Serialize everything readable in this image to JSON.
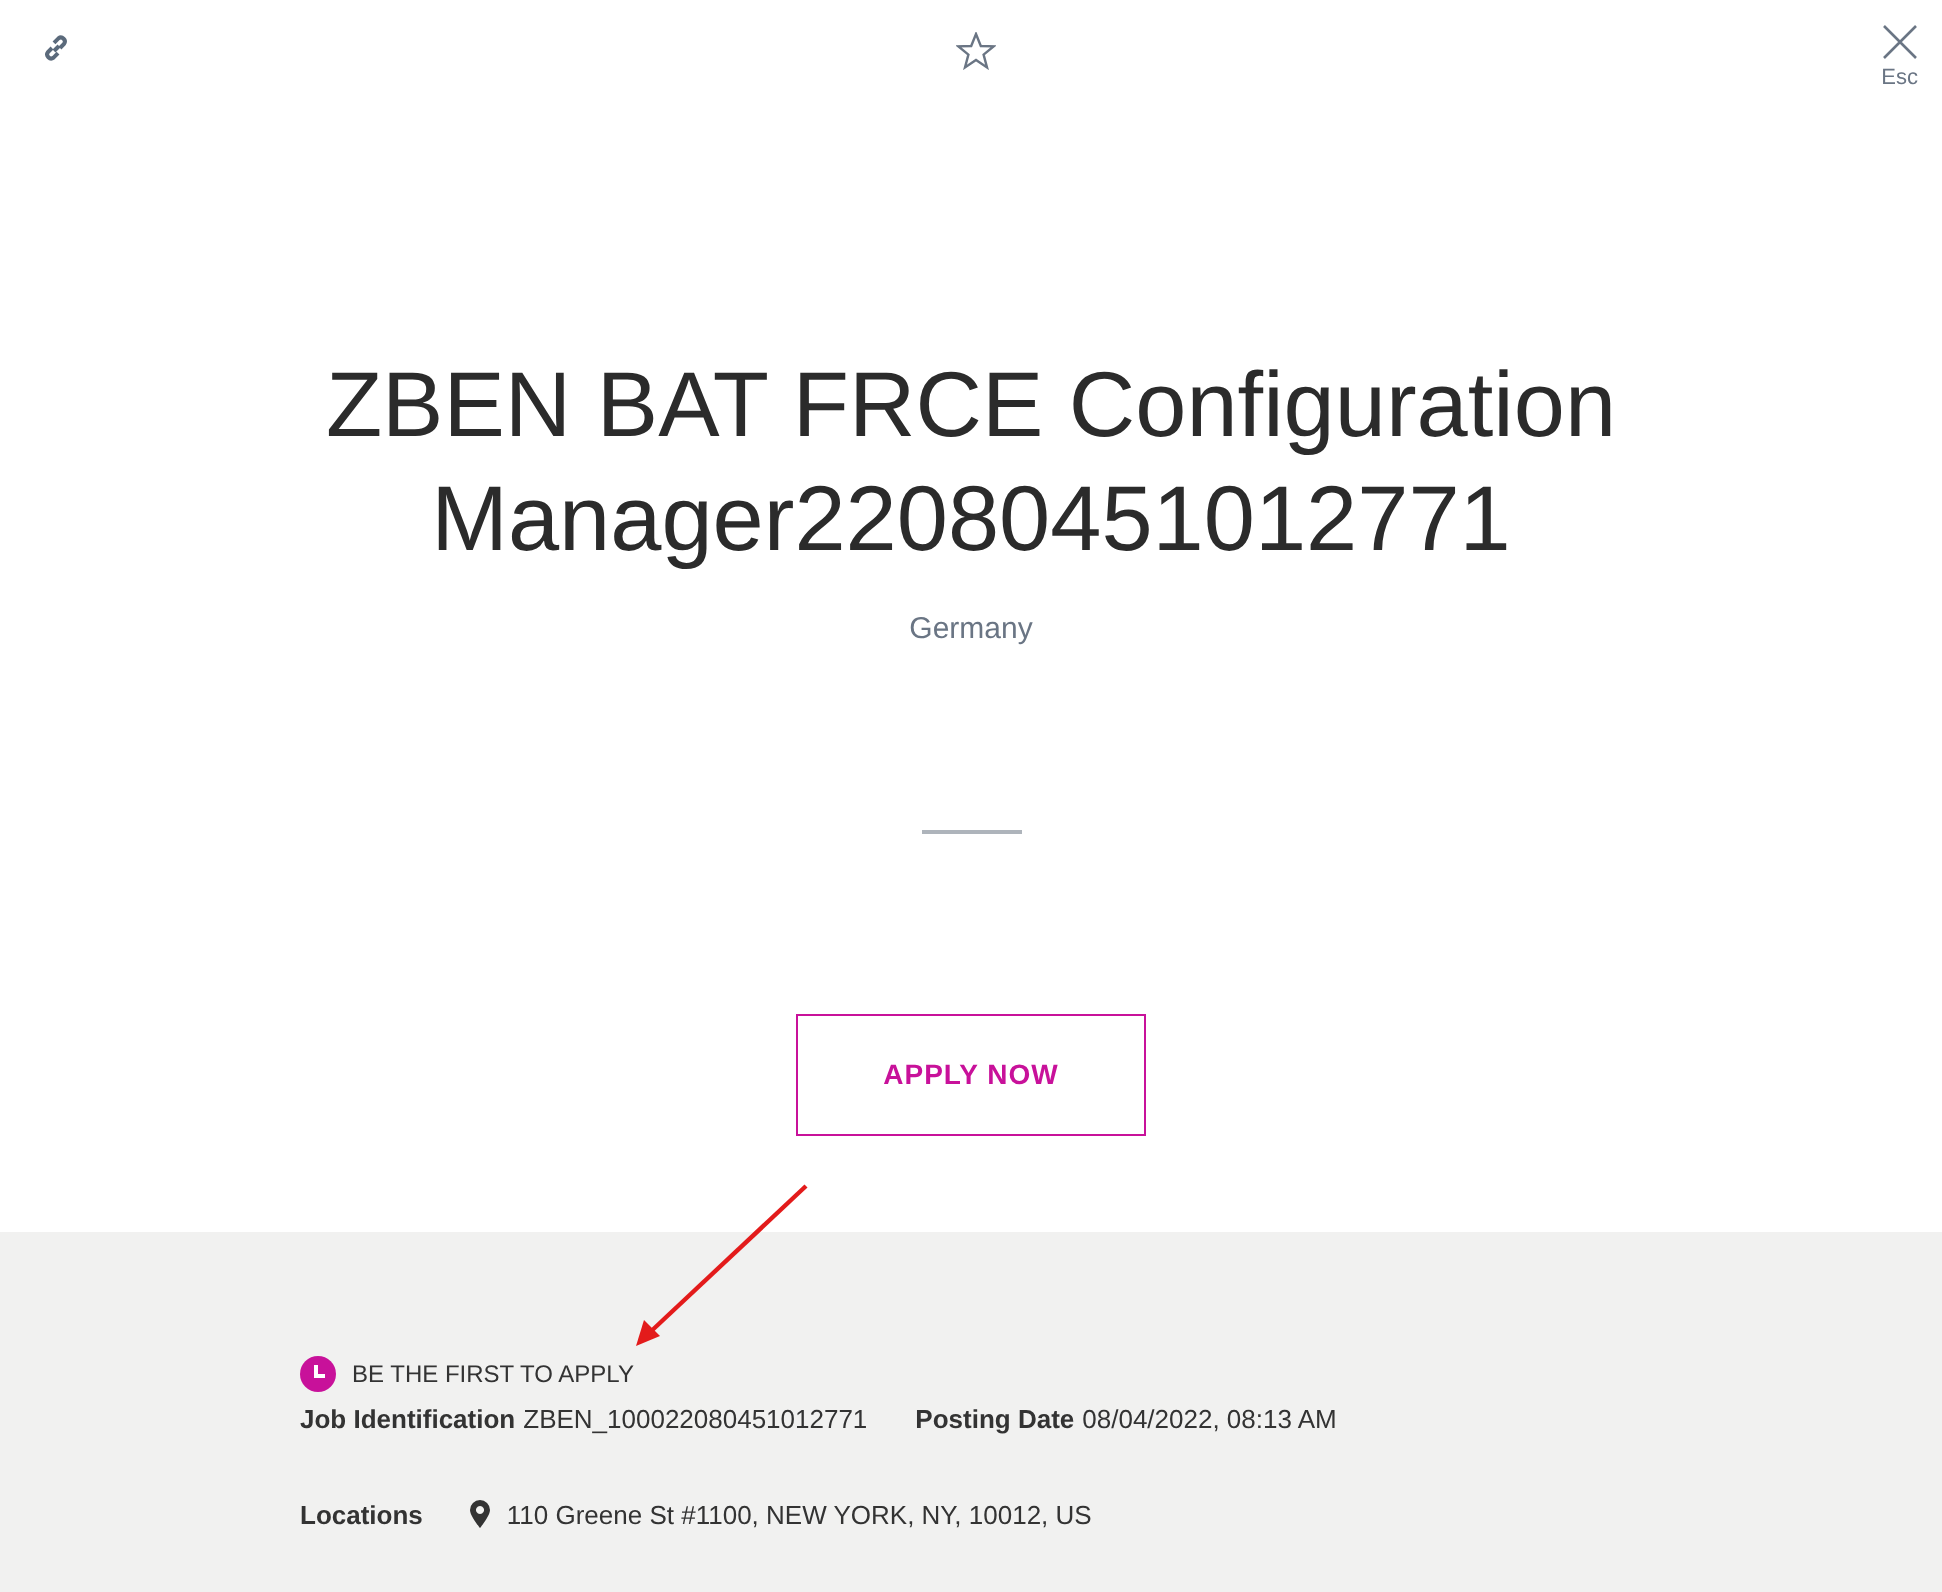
{
  "toolbar": {
    "close_hint": "Esc"
  },
  "job": {
    "title": "ZBEN BAT FRCE Configuration Manager22080451012771",
    "country": "Germany",
    "apply_label": "APPLY NOW"
  },
  "details": {
    "badge": "BE THE FIRST TO APPLY",
    "fields": [
      {
        "label": "Job Identification",
        "value": "ZBEN_100022080451012771"
      },
      {
        "label": "Posting Date",
        "value": "08/04/2022, 08:13 AM"
      }
    ],
    "locations_label": "Locations",
    "locations": [
      "110 Greene St #1100, NEW YORK, NY, 10012, US"
    ]
  }
}
